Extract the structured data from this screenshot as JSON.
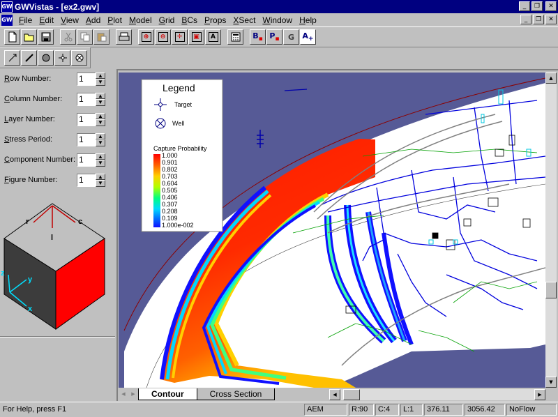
{
  "window": {
    "title": "GWVistas - [ex2.gwv]",
    "app_icon": "GW",
    "minimize": "_",
    "restore": "❐",
    "close": "✕"
  },
  "menu": {
    "items": [
      {
        "u": "F",
        "rest": "ile"
      },
      {
        "u": "E",
        "rest": "dit"
      },
      {
        "u": "V",
        "rest": "iew"
      },
      {
        "u": "A",
        "rest": "dd"
      },
      {
        "u": "P",
        "rest": "lot"
      },
      {
        "u": "M",
        "rest": "odel"
      },
      {
        "u": "G",
        "rest": "rid"
      },
      {
        "u": "B",
        "rest": "Cs"
      },
      {
        "u": "P",
        "rest": "rops"
      },
      {
        "u": "X",
        "rest": "Sect"
      },
      {
        "u": "W",
        "rest": "indow"
      },
      {
        "u": "H",
        "rest": "elp"
      }
    ]
  },
  "fields": [
    {
      "u": "R",
      "rest": "ow Number:",
      "value": "1"
    },
    {
      "u": "C",
      "rest": "olumn Number:",
      "value": "1"
    },
    {
      "u": "L",
      "rest": "ayer Number:",
      "value": "1"
    },
    {
      "u": "S",
      "rest": "tress Period:",
      "value": "1"
    },
    {
      "u": "C",
      "rest": "omponent Number:",
      "value": "1"
    },
    {
      "u": "F",
      "rest": "igure Number:",
      "value": "1"
    }
  ],
  "cube": {
    "r": "r",
    "c": "c",
    "l": "l",
    "x": "x",
    "y": "y",
    "z": "z",
    "face_color": "#ff0000",
    "side_color": "#3c3c3c"
  },
  "legend": {
    "title": "Legend",
    "target_label": "Target",
    "well_label": "Well",
    "colorbar_title": "Capture Probability",
    "ticks": [
      "1.000",
      "0.901",
      "0.802",
      "0.703",
      "0.604",
      "0.505",
      "0.406",
      "0.307",
      "0.208",
      "0.109",
      "1.000e-002"
    ]
  },
  "tabs": {
    "active": "Contour",
    "inactive": "Cross Section"
  },
  "status": {
    "help": "For Help, press F1",
    "model": "AEM",
    "row": "R:90",
    "col": "C:4",
    "layer": "L:1",
    "x": "376.11",
    "y": "3056.42",
    "flow": "NoFlow"
  },
  "colors": {
    "inactive_area": "#565a96",
    "titlebar": "#000080",
    "road": "#0000dd",
    "plume_high": "#ff1a00"
  }
}
